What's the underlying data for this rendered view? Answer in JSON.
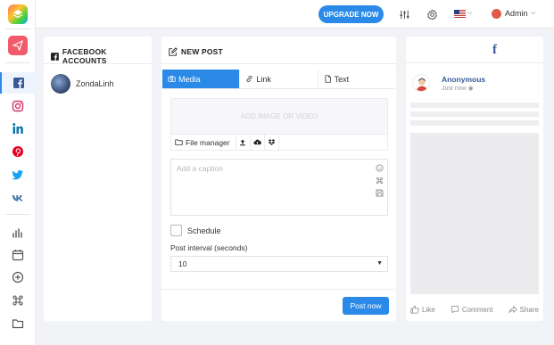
{
  "topbar": {
    "upgrade_label": "UPGRADE NOW",
    "user_name": "Admin"
  },
  "accounts_panel": {
    "title": "FACEBOOK ACCOUNTS",
    "accounts": [
      {
        "name": "ZondaLinh"
      }
    ]
  },
  "post_panel": {
    "title": "NEW POST",
    "tabs": [
      {
        "label": "Media",
        "active": true
      },
      {
        "label": "Link",
        "active": false
      },
      {
        "label": "Text",
        "active": false
      }
    ],
    "dropzone_text": "ADD IMAGE OR VIDEO",
    "file_manager_label": "File manager",
    "caption_placeholder": "Add a caption",
    "schedule_label": "Schedule",
    "interval_label": "Post interval (seconds)",
    "interval_value": "10",
    "submit_label": "Post now"
  },
  "preview": {
    "network_logo": "f",
    "user_name": "Anonymous",
    "time_text": "Just now",
    "actions": [
      "Like",
      "Comment",
      "Share"
    ]
  },
  "colors": {
    "accent": "#2b8ae8",
    "facebook": "#3b5998",
    "send_button": "#f25b6c"
  }
}
